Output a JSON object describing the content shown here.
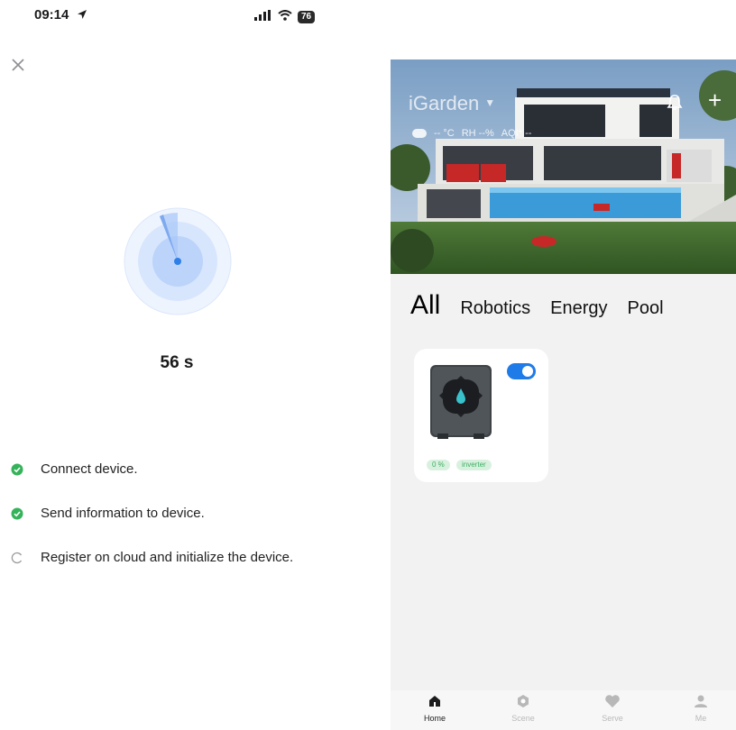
{
  "status_bar": {
    "time": "09:14",
    "battery": "76"
  },
  "pairing": {
    "timer": "56 s",
    "steps": [
      {
        "label": "Connect device.",
        "state": "done"
      },
      {
        "label": "Send information to device.",
        "state": "done"
      },
      {
        "label": "Register on cloud and initialize the device.",
        "state": "loading"
      }
    ]
  },
  "home": {
    "name": "iGarden",
    "weather": {
      "temp": "-- °C",
      "rh": "RH --%",
      "aqi": "AQI* --"
    },
    "tabs": [
      "All",
      "Robotics",
      "Energy",
      "Pool"
    ],
    "active_tab": "All",
    "device": {
      "badge_percent": "0 %",
      "badge_type": "inverter",
      "power_on": true
    },
    "nav": [
      {
        "label": "Home",
        "icon": "home-icon"
      },
      {
        "label": "Scene",
        "icon": "scene-icon"
      },
      {
        "label": "Serve",
        "icon": "heart-icon"
      },
      {
        "label": "Me",
        "icon": "user-icon"
      }
    ]
  },
  "colors": {
    "accent": "#1f7be8",
    "success": "#35b35a",
    "radar": "#8fb8f5",
    "panel_bg": "#f2f2f2"
  }
}
